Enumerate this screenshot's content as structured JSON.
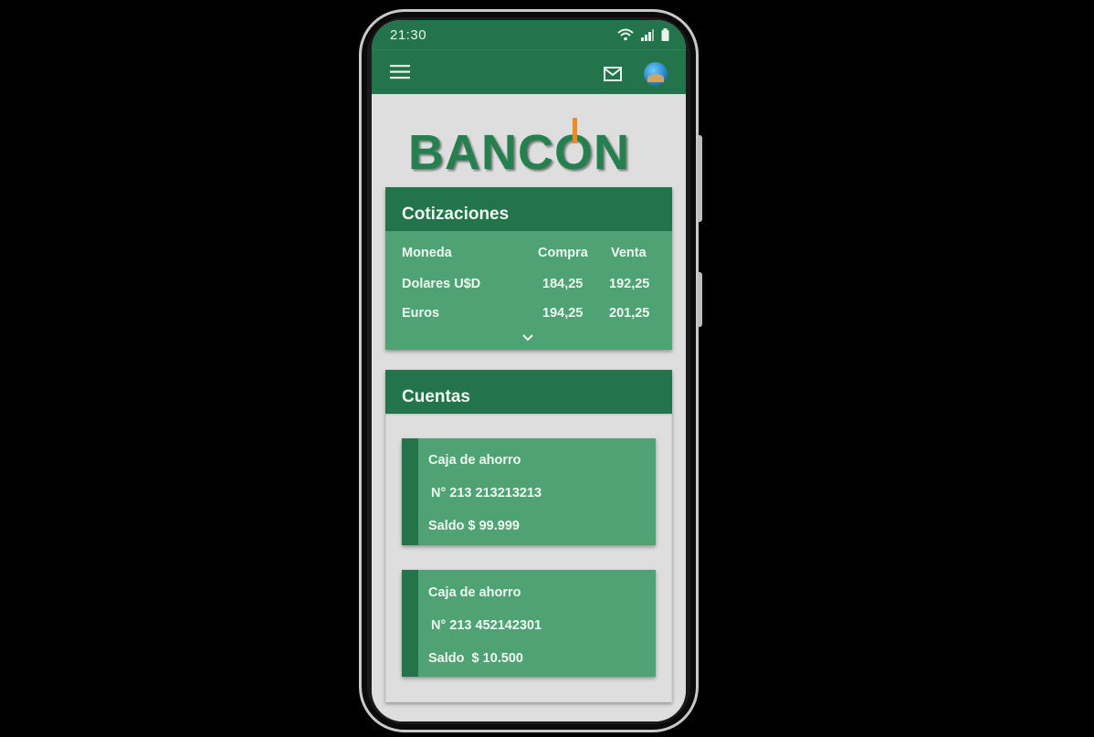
{
  "status_bar": {
    "time": "21:30"
  },
  "app_bar": {
    "menu_icon": "hamburger-menu-icon",
    "mail_icon": "mail-icon",
    "avatar": "user-avatar"
  },
  "logo": {
    "text_before": "BANC",
    "text_o": "O",
    "text_after": "N",
    "accent_color": "#f08a1e",
    "brand_color": "#24814f"
  },
  "cotizaciones": {
    "title": "Cotizaciones",
    "headers": {
      "moneda": "Moneda",
      "compra": "Compra",
      "venta": "Venta"
    },
    "rows": [
      {
        "moneda": "Dolares U$D",
        "compra": "184,25",
        "venta": "192,25"
      },
      {
        "moneda": "Euros",
        "compra": "194,25",
        "venta": "201,25"
      }
    ],
    "expand_icon": "chevron-down-icon"
  },
  "cuentas": {
    "title": "Cuentas",
    "accounts": [
      {
        "type": "Caja de ahorro",
        "number": "N° 213 213213213",
        "balance": "Saldo $ 99.999"
      },
      {
        "type": "Caja de ahorro",
        "number": "N° 213 452142301",
        "balance": "Saldo  $ 10.500"
      }
    ]
  },
  "colors": {
    "primary": "#23744a",
    "card": "#4fa273",
    "background": "#dedede"
  }
}
